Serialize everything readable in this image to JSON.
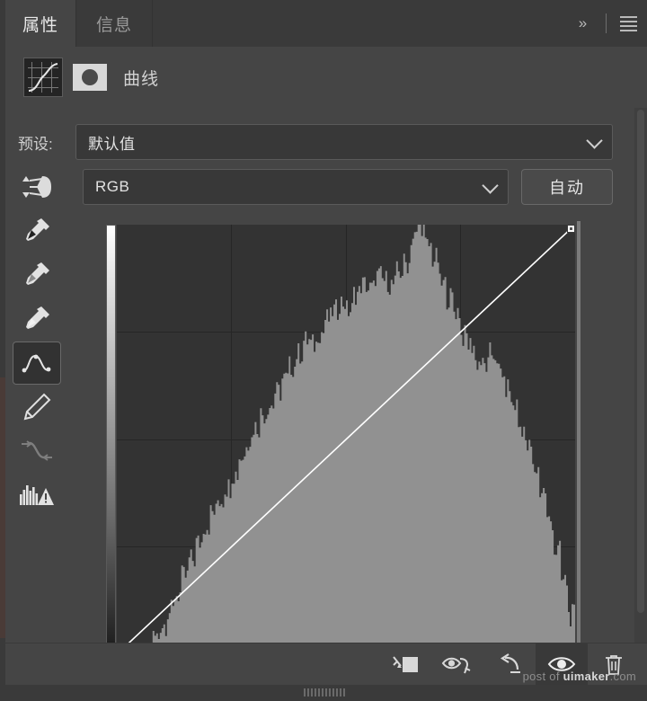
{
  "window": {
    "title": "曲线",
    "tabs": [
      {
        "id": "tab-properties",
        "label": "属性",
        "active": true
      },
      {
        "id": "tab-info",
        "label": "信息",
        "active": false
      }
    ],
    "collapse_icon": "chevron-double-right-icon",
    "menu_icon": "panel-menu-icon"
  },
  "header": {
    "adjustment_icon": "curves-thumbnail-icon",
    "mask_icon": "layer-mask-thumbnail-icon",
    "title": "曲线"
  },
  "preset": {
    "label": "预设:",
    "value": "默认值",
    "chevron": "chevron-down-icon"
  },
  "channel": {
    "on_image_icon": "on-image-adjustment-icon",
    "value": "RGB",
    "chevron": "chevron-down-icon",
    "auto_label": "自动"
  },
  "tools": [
    {
      "name": "on-image-adjustment-tool",
      "selected": false
    },
    {
      "name": "black-point-eyedropper",
      "selected": false
    },
    {
      "name": "gray-point-eyedropper",
      "selected": false
    },
    {
      "name": "white-point-eyedropper",
      "selected": false
    },
    {
      "name": "curve-point-tool",
      "selected": true
    },
    {
      "name": "pencil-tool",
      "selected": false
    },
    {
      "name": "smooth-curve-tool",
      "selected": false,
      "disabled": true
    },
    {
      "name": "histogram-warning-icon",
      "selected": false
    }
  ],
  "bottom_toolbar": [
    {
      "name": "clip-to-layer-button",
      "active": false
    },
    {
      "name": "toggle-layer-visibility-previous-button",
      "active": false
    },
    {
      "name": "reset-adjustment-button",
      "active": false
    },
    {
      "name": "toggle-layer-visibility-button",
      "active": true
    },
    {
      "name": "delete-adjustment-layer-button",
      "active": false
    }
  ],
  "watermark": {
    "prefix": "post of ",
    "brand": "uimaker",
    "suffix": ".com"
  },
  "chart_data": {
    "type": "line",
    "title": "曲线",
    "xlabel": "",
    "ylabel": "",
    "xlim": [
      0,
      255
    ],
    "ylim": [
      0,
      255
    ],
    "grid": true,
    "grid_divisions": 4,
    "curve_points": [
      {
        "input": 0,
        "output": 0
      },
      {
        "input": 255,
        "output": 255
      }
    ],
    "selected_point": {
      "input": 255,
      "output": 255
    },
    "histogram": {
      "channel": "RGB",
      "bins": 64,
      "values": [
        0.0,
        0.0,
        0.0,
        0.01,
        0.02,
        0.04,
        0.07,
        0.1,
        0.14,
        0.18,
        0.22,
        0.26,
        0.3,
        0.33,
        0.36,
        0.39,
        0.42,
        0.46,
        0.5,
        0.53,
        0.56,
        0.58,
        0.61,
        0.64,
        0.67,
        0.7,
        0.73,
        0.72,
        0.75,
        0.78,
        0.8,
        0.82,
        0.8,
        0.84,
        0.86,
        0.85,
        0.88,
        0.87,
        0.86,
        0.89,
        0.91,
        0.97,
        1.0,
        0.95,
        0.92,
        0.86,
        0.83,
        0.8,
        0.74,
        0.72,
        0.68,
        0.67,
        0.7,
        0.66,
        0.62,
        0.58,
        0.53,
        0.48,
        0.43,
        0.38,
        0.31,
        0.24,
        0.17,
        0.09
      ]
    }
  }
}
